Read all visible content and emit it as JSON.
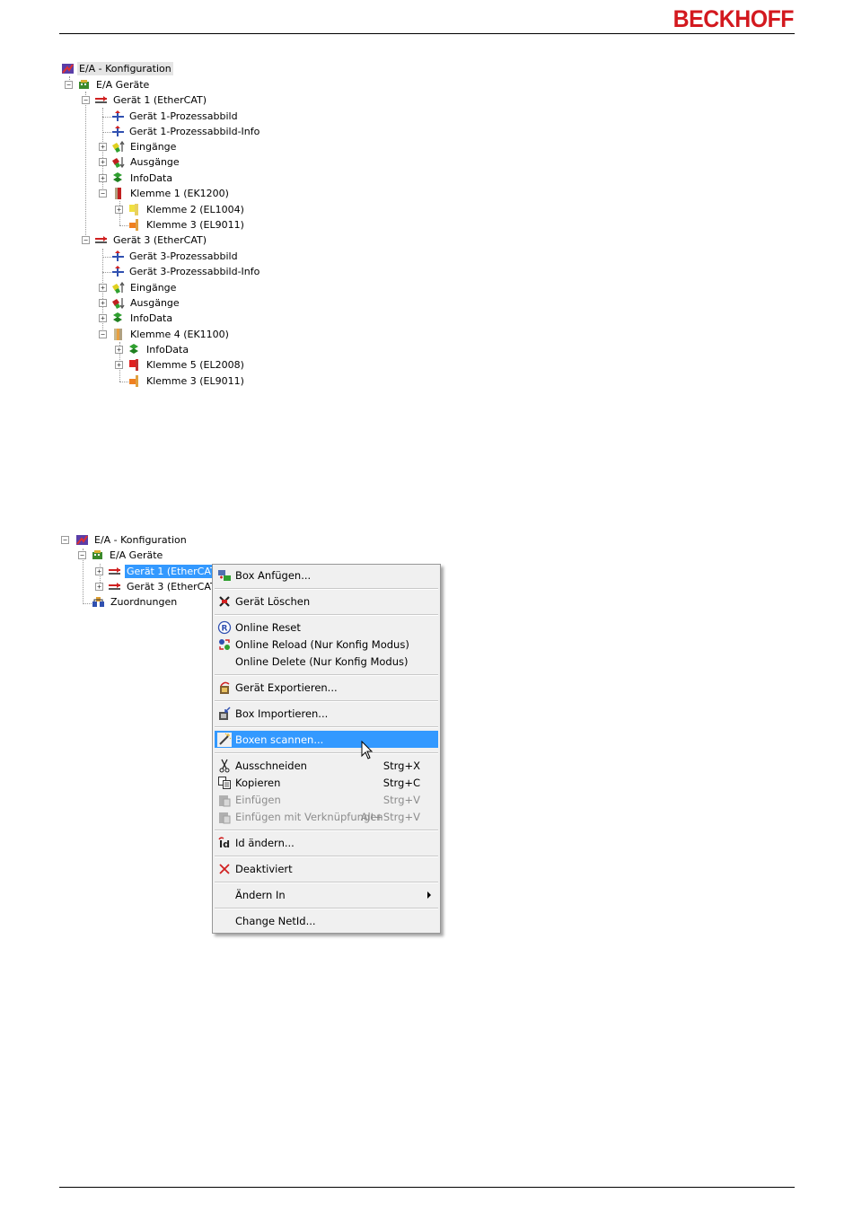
{
  "brand": {
    "logo_text": "BECKHOFF",
    "color": "#d3191f"
  },
  "tree1": {
    "items": [
      {
        "label": "E/A - Konfiguration",
        "icon": "config-icon"
      },
      {
        "label": "E/A Geräte",
        "icon": "io-devices-icon"
      },
      {
        "label": "Gerät 1 (EtherCAT)",
        "icon": "ethercat-device-icon"
      },
      {
        "label": "Gerät 1-Prozessabbild",
        "icon": "process-image-icon"
      },
      {
        "label": "Gerät 1-Prozessabbild-Info",
        "icon": "process-image-icon"
      },
      {
        "label": "Eingänge",
        "icon": "inputs-icon"
      },
      {
        "label": "Ausgänge",
        "icon": "outputs-icon"
      },
      {
        "label": "InfoData",
        "icon": "infodata-icon"
      },
      {
        "label": "Klemme 1 (EK1200)",
        "icon": "terminal-icon"
      },
      {
        "label": "Klemme 2 (EL1004)",
        "icon": "terminal-icon"
      },
      {
        "label": "Klemme 3 (EL9011)",
        "icon": "terminal-end-icon"
      },
      {
        "label": "Gerät 3 (EtherCAT)",
        "icon": "ethercat-device-icon"
      },
      {
        "label": "Gerät 3-Prozessabbild",
        "icon": "process-image-icon"
      },
      {
        "label": "Gerät 3-Prozessabbild-Info",
        "icon": "process-image-icon"
      },
      {
        "label": "Eingänge",
        "icon": "inputs-icon"
      },
      {
        "label": "Ausgänge",
        "icon": "outputs-icon"
      },
      {
        "label": "InfoData",
        "icon": "infodata-icon"
      },
      {
        "label": "Klemme 4 (EK1100)",
        "icon": "terminal-icon"
      },
      {
        "label": "InfoData",
        "icon": "infodata-icon"
      },
      {
        "label": "Klemme 5 (EL2008)",
        "icon": "terminal-icon"
      },
      {
        "label": "Klemme 3 (EL9011)",
        "icon": "terminal-end-icon"
      }
    ]
  },
  "tree2": {
    "items": [
      {
        "label": "E/A - Konfiguration",
        "icon": "config-icon"
      },
      {
        "label": "E/A Geräte",
        "icon": "io-devices-icon"
      },
      {
        "label": "Gerät 1 (EtherCAT)",
        "icon": "ethercat-device-icon"
      },
      {
        "label": "Gerät 3 (EtherCAT)",
        "icon": "ethercat-device-icon"
      },
      {
        "label": "Zuordnungen",
        "icon": "mappings-icon"
      }
    ]
  },
  "context_menu": {
    "items": [
      {
        "label": "Box Anfügen...",
        "icon": "add-box-icon",
        "enabled": true
      },
      {
        "label": "Gerät Löschen",
        "icon": "delete-icon",
        "enabled": true
      },
      {
        "label": "Online Reset",
        "icon": "reset-icon",
        "enabled": true
      },
      {
        "label": "Online Reload (Nur Konfig Modus)",
        "icon": "reload-icon",
        "enabled": true
      },
      {
        "label": "Online Delete (Nur Konfig Modus)",
        "icon": "",
        "enabled": true
      },
      {
        "label": "Gerät Exportieren...",
        "icon": "export-icon",
        "enabled": true
      },
      {
        "label": "Box Importieren...",
        "icon": "import-icon",
        "enabled": true
      },
      {
        "label": "Boxen scannen...",
        "icon": "scan-wand-icon",
        "enabled": true,
        "highlighted": true
      },
      {
        "label": "Ausschneiden",
        "icon": "cut-icon",
        "shortcut": "Strg+X",
        "enabled": true
      },
      {
        "label": "Kopieren",
        "icon": "copy-icon",
        "shortcut": "Strg+C",
        "enabled": true
      },
      {
        "label": "Einfügen",
        "icon": "paste-icon",
        "shortcut": "Strg+V",
        "enabled": false
      },
      {
        "label": "Einfügen mit Verknüpfungen",
        "icon": "paste-links-icon",
        "shortcut": "Alt+Strg+V",
        "enabled": false
      },
      {
        "label": "Id ändern...",
        "icon": "change-id-icon",
        "enabled": true
      },
      {
        "label": "Deaktiviert",
        "icon": "deactivate-icon",
        "enabled": true
      },
      {
        "label": "Ändern In",
        "icon": "",
        "enabled": true,
        "submenu": true
      },
      {
        "label": "Change NetId...",
        "icon": "",
        "enabled": true
      }
    ]
  },
  "colors": {
    "selection": "#3399ff",
    "menu_bg": "#f0f0f0"
  }
}
